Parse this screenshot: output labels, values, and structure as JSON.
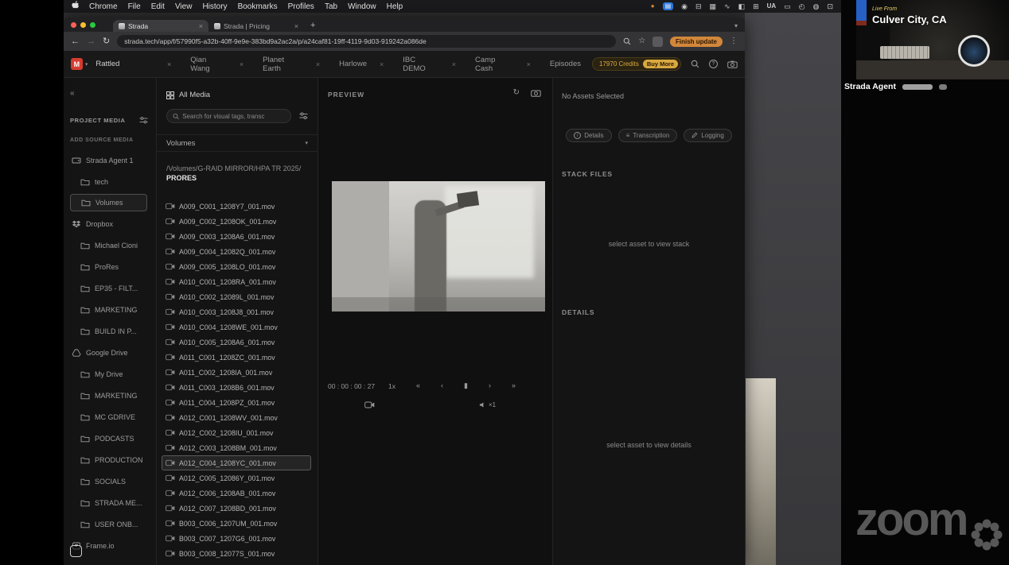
{
  "glyphs": {
    "close": "×",
    "add": "+",
    "dropdown": "▾",
    "back": "←",
    "forward": "→",
    "reload": "↻",
    "star": "☆",
    "more": "⋮",
    "collapse": "«",
    "question": "?",
    "info": "i",
    "lines": "≡"
  },
  "menubar": {
    "menus": [
      "Chrome",
      "File",
      "Edit",
      "View",
      "History",
      "Bookmarks",
      "Profiles",
      "Tab",
      "Window",
      "Help"
    ],
    "status_icons": [
      {
        "name": "screen-recording-dot-icon",
        "glyph": "●",
        "style": "rec"
      },
      {
        "name": "screen-share-indicator-icon",
        "glyph": "▤",
        "style": "active"
      },
      {
        "name": "camera-status-icon",
        "glyph": "◉"
      },
      {
        "name": "display-status-icon",
        "glyph": "⊟"
      },
      {
        "name": "window-manager-icon",
        "glyph": "▦"
      },
      {
        "name": "audio-wave-icon",
        "glyph": "∿"
      },
      {
        "name": "sidecar-icon",
        "glyph": "◧"
      },
      {
        "name": "grid-status-icon",
        "glyph": "⊞"
      },
      {
        "name": "keyboard-layout-indicator",
        "glyph": "UA",
        "style": "text"
      },
      {
        "name": "battery-icon",
        "glyph": "▭"
      },
      {
        "name": "clock-status-icon",
        "glyph": "◴"
      },
      {
        "name": "control-center-icon",
        "glyph": "◍"
      },
      {
        "name": "external-display-icon",
        "glyph": "⊡"
      }
    ]
  },
  "browser": {
    "tabs": [
      {
        "title": "Strada",
        "active": true
      },
      {
        "title": "Strada | Pricing",
        "active": false
      }
    ],
    "url": "strada.tech/app/f/57990f5-a32b-40ff-9e9e-383bd9a2ac2a/p/a24caf81-19ff-4119-9d03-919242a086de",
    "update_button": "Finish update"
  },
  "app": {
    "header": {
      "logo": "M",
      "workspace": "Rattled",
      "tabs": [
        {
          "label": "Qian Wang"
        },
        {
          "label": "Planet Earth"
        },
        {
          "label": "Harlowe"
        },
        {
          "label": "IBC DEMO"
        },
        {
          "label": "Camp Cash"
        },
        {
          "label": "Episodes",
          "no_close": true
        }
      ],
      "credits": "17970 Credits",
      "buy_more": "Buy More"
    },
    "sidebar": {
      "project_media": "PROJECT MEDIA",
      "add_source_media": "ADD SOURCE MEDIA",
      "items": [
        {
          "label": "Strada Agent 1",
          "icon": "agent-icon",
          "indent": 0
        },
        {
          "label": "tech",
          "icon": "folder-icon",
          "indent": 1
        },
        {
          "label": "Volumes",
          "icon": "folder-icon",
          "indent": 1,
          "selected": true
        },
        {
          "label": "Dropbox",
          "icon": "dropbox-icon",
          "indent": 0
        },
        {
          "label": "Michael Cioni",
          "icon": "folder-icon",
          "indent": 1
        },
        {
          "label": "ProRes",
          "icon": "folder-icon",
          "indent": 1
        },
        {
          "label": "EP35 - FILT...",
          "icon": "folder-icon",
          "indent": 1
        },
        {
          "label": "MARKETING",
          "icon": "folder-icon",
          "indent": 1
        },
        {
          "label": "BUILD IN P...",
          "icon": "folder-icon",
          "indent": 1
        },
        {
          "label": "Google Drive",
          "icon": "google-drive-icon",
          "indent": 0
        },
        {
          "label": "My Drive",
          "icon": "folder-icon",
          "indent": 1
        },
        {
          "label": "MARKETING",
          "icon": "folder-icon",
          "indent": 1
        },
        {
          "label": "MC GDRIVE",
          "icon": "folder-icon",
          "indent": 1
        },
        {
          "label": "PODCASTS",
          "icon": "folder-icon",
          "indent": 1
        },
        {
          "label": "PRODUCTION",
          "icon": "folder-icon",
          "indent": 1
        },
        {
          "label": "SOCIALS",
          "icon": "folder-icon",
          "indent": 1
        },
        {
          "label": "STRADA ME...",
          "icon": "folder-icon",
          "indent": 1
        },
        {
          "label": "USER ONB...",
          "icon": "folder-icon",
          "indent": 1
        },
        {
          "label": "Frame.io",
          "icon": "frameio-icon",
          "indent": 0
        }
      ]
    },
    "media": {
      "title": "All Media",
      "search_placeholder": "Search for visual tags, transc",
      "source": "Volumes",
      "path_prefix": "/Volumes/G-RAID MIRROR/HPA TR 2025/",
      "path_current": "PRORES",
      "files": [
        {
          "name": "A009_C001_1208Y7_001.mov"
        },
        {
          "name": "A009_C002_1208OK_001.mov"
        },
        {
          "name": "A009_C003_1208A6_001.mov"
        },
        {
          "name": "A009_C004_12082Q_001.mov"
        },
        {
          "name": "A009_C005_1208LO_001.mov"
        },
        {
          "name": "A010_C001_1208RA_001.mov"
        },
        {
          "name": "A010_C002_12089L_001.mov"
        },
        {
          "name": "A010_C003_1208J8_001.mov"
        },
        {
          "name": "A010_C004_1208WE_001.mov"
        },
        {
          "name": "A010_C005_1208A6_001.mov"
        },
        {
          "name": "A011_C001_1208ZC_001.mov"
        },
        {
          "name": "A011_C002_1208IA_001.mov"
        },
        {
          "name": "A011_C003_1208B6_001.mov"
        },
        {
          "name": "A011_C004_1208PZ_001.mov"
        },
        {
          "name": "A012_C001_1208WV_001.mov"
        },
        {
          "name": "A012_C002_1208IU_001.mov"
        },
        {
          "name": "A012_C003_1208BM_001.mov"
        },
        {
          "name": "A012_C004_1208YC_001.mov",
          "selected": true
        },
        {
          "name": "A012_C005_12086Y_001.mov"
        },
        {
          "name": "A012_C006_1208AB_001.mov"
        },
        {
          "name": "A012_C007_1208BD_001.mov"
        },
        {
          "name": "B003_C006_1207UM_001.mov"
        },
        {
          "name": "B003_C007_1207G6_001.mov"
        },
        {
          "name": "B003_C008_12077S_001.mov"
        }
      ]
    },
    "preview": {
      "title": "PREVIEW",
      "timecode": "00 : 00 : 00 : 27",
      "speed": "1x",
      "transport": [
        {
          "name": "jump-to-start-icon",
          "glyph": "«"
        },
        {
          "name": "step-back-icon",
          "glyph": "‹"
        },
        {
          "name": "pause-icon",
          "glyph": "▮"
        },
        {
          "name": "step-forward-icon",
          "glyph": "›"
        },
        {
          "name": "jump-to-end-icon",
          "glyph": "»"
        }
      ],
      "audio_rate": "×1"
    },
    "inspector": {
      "empty_title": "No Assets Selected",
      "actions": [
        "Details",
        "Transcription",
        "Logging"
      ],
      "stack_label": "STACK FILES",
      "stack_empty": "select asset to view stack",
      "details_label": "DETAILS",
      "details_empty": "select asset to view details"
    }
  },
  "zoom": {
    "live_from": "Live From",
    "location": "Culver City, CA",
    "participant": "Strada Agent",
    "watermark": "zoom"
  }
}
